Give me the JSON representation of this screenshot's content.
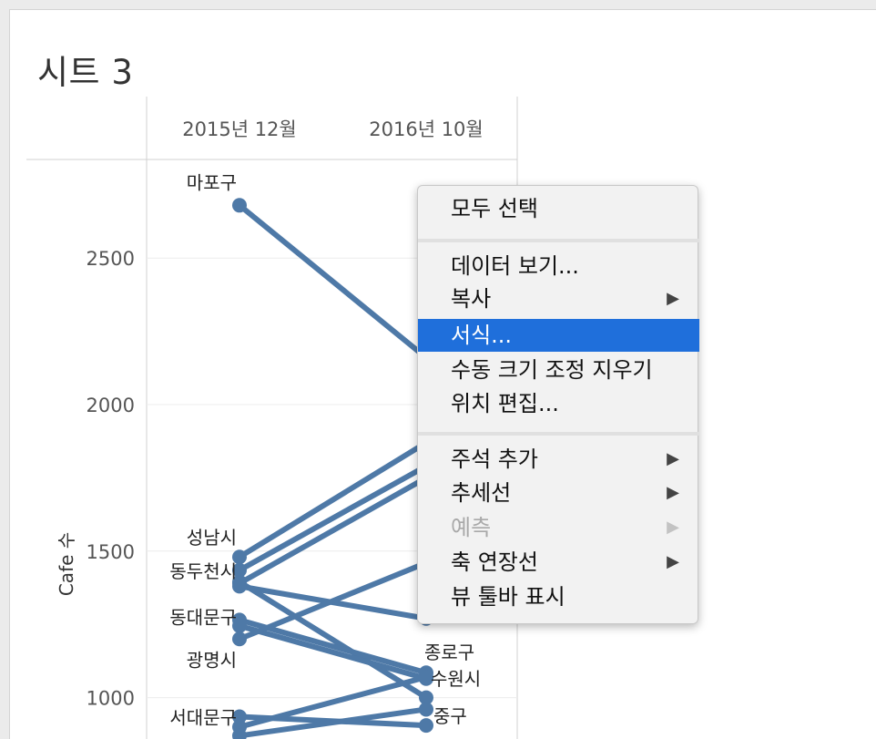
{
  "sheet": {
    "title": "시트 3"
  },
  "chart_data": {
    "type": "line",
    "x_categories": [
      "2015년 12월",
      "2016년 10월"
    ],
    "ylabel": "Cafe 수",
    "yticks": [
      1000,
      1500,
      2000,
      2500
    ],
    "ylim": [
      820,
      2780
    ],
    "series": [
      {
        "name": "마포구",
        "values": [
          2680,
          2160
        ]
      },
      {
        "name": "성남시",
        "values": [
          1480,
          1870
        ]
      },
      {
        "name": "",
        "values": [
          1435,
          1790
        ]
      },
      {
        "name": "동두천시",
        "values": [
          1390,
          1750
        ]
      },
      {
        "name": "",
        "values": [
          1380,
          1270
        ]
      },
      {
        "name": "",
        "values": [
          1395,
          1000
        ]
      },
      {
        "name": "동대문구",
        "values": [
          1265,
          1085
        ]
      },
      {
        "name": "",
        "values": [
          1245,
          1065
        ]
      },
      {
        "name": "광명시",
        "values": [
          1200,
          1460
        ]
      },
      {
        "name": "서대문구",
        "values": [
          935,
          905
        ]
      },
      {
        "name": "",
        "values": [
          900,
          1070
        ]
      },
      {
        "name": "",
        "values": [
          870,
          960
        ]
      }
    ],
    "labels_left": [
      {
        "text": "마포구",
        "value": 2680
      },
      {
        "text": "성남시",
        "value": 1480
      },
      {
        "text": "동두천시",
        "value": 1390
      },
      {
        "text": "동대문구",
        "value": 1265
      },
      {
        "text": "광명시",
        "value": 1200
      },
      {
        "text": "서대문구",
        "value": 935
      }
    ],
    "labels_right": [
      {
        "text": "종로구",
        "value": 1085
      },
      {
        "text": "수원시",
        "value": 1065
      },
      {
        "text": "중구",
        "value": 1000
      }
    ]
  },
  "context_menu": {
    "items": [
      {
        "label": "모두 선택",
        "arrow": false,
        "disabled": false,
        "highlighted": false
      },
      {
        "label": "데이터 보기...",
        "arrow": false,
        "disabled": false,
        "highlighted": false
      },
      {
        "label": "복사",
        "arrow": true,
        "disabled": false,
        "highlighted": false
      },
      {
        "label": "서식...",
        "arrow": false,
        "disabled": false,
        "highlighted": true
      },
      {
        "label": "수동 크기 조정 지우기",
        "arrow": false,
        "disabled": false,
        "highlighted": false
      },
      {
        "label": "위치 편집...",
        "arrow": false,
        "disabled": false,
        "highlighted": false
      },
      {
        "label": "주석 추가",
        "arrow": true,
        "disabled": false,
        "highlighted": false
      },
      {
        "label": "추세선",
        "arrow": true,
        "disabled": false,
        "highlighted": false
      },
      {
        "label": "예측",
        "arrow": true,
        "disabled": true,
        "highlighted": false
      },
      {
        "label": "축 연장선",
        "arrow": true,
        "disabled": false,
        "highlighted": false
      },
      {
        "label": "뷰 툴바 표시",
        "arrow": false,
        "disabled": false,
        "highlighted": false
      }
    ],
    "arrow_glyph": "▶"
  },
  "colors": {
    "line": "#4e79a7",
    "highlight": "#1f6fdb"
  }
}
